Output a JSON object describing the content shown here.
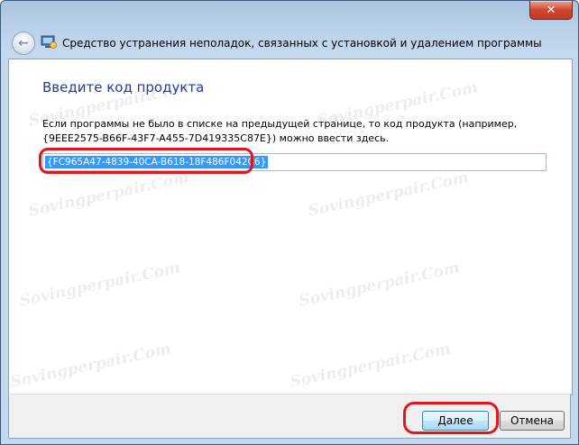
{
  "window": {
    "title": "Средство устранения неполадок, связанных с установкой и удалением программы",
    "close_label": "✕"
  },
  "page": {
    "heading": "Введите код продукта",
    "description_line1": "Если программы не было в списке на предыдущей странице, то код продукта (например,",
    "description_line2": "{9EEE2575-B66F-43F7-A455-7D419335C87E}) можно ввести здесь.",
    "product_code_value": "{FC965A47-4839-40CA-B618-18F486F042C6}"
  },
  "footer": {
    "next_label": "Далее",
    "cancel_label": "Отмена"
  },
  "watermark": {
    "text": "Sovingperpair.Com"
  },
  "colors": {
    "highlight": "#e0161c",
    "heading": "#1e3d9b",
    "selection": "#3399ff"
  },
  "icons": {
    "back": "back-arrow-icon",
    "app": "troubleshooter-app-icon",
    "close": "close-icon"
  }
}
